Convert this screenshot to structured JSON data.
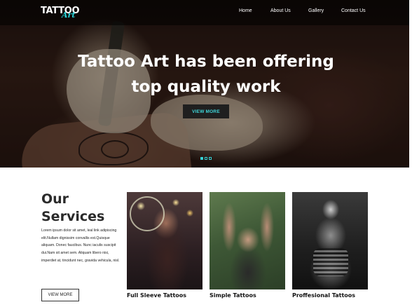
{
  "brand": {
    "logo_main": "TATTOO",
    "logo_sub": "Art",
    "accent_color": "#36d1d6"
  },
  "nav": {
    "items": [
      {
        "label": "Home"
      },
      {
        "label": "About Us"
      },
      {
        "label": "Gallery"
      },
      {
        "label": "Contact Us"
      }
    ]
  },
  "hero": {
    "title_line1": "Tattoo Art has been offering",
    "title_line2": "top quality work",
    "button_label": "VIEW MORE",
    "slides": 3,
    "active_slide": 1
  },
  "services": {
    "title_line1": "Our",
    "title_line2": "Services",
    "description": "Lorem ipsum dolor sit amet, leal link adipiscing elit.Nullam dignissim convallis est.Quisque aliquam. Donec faucibus. Nunc iaculis suscipit dui.Nam sit amet sem. Aliquam libero nisi, imperdiet at, tincidunt nec, gravida vehicula, nisl.",
    "button_label": "VIEW MORE",
    "cards": [
      {
        "label": "Full Sleeve Tattoos"
      },
      {
        "label": "Simple Tattoos"
      },
      {
        "label": "Proffesional Tattoos"
      }
    ]
  }
}
